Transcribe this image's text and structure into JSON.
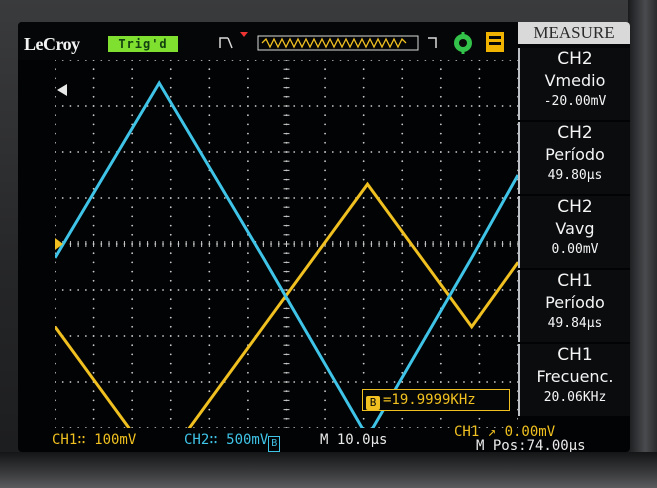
{
  "brand": "LeCroy",
  "run_status": "Trig'd",
  "header": {
    "mode": "MEASURE"
  },
  "measurements": [
    {
      "channel": "CH2",
      "name": "Vmedio",
      "value": "-20.00mV"
    },
    {
      "channel": "CH2",
      "name": "Período",
      "value": "49.80µs"
    },
    {
      "channel": "CH2",
      "name": "Vavg",
      "value": "0.00mV"
    },
    {
      "channel": "CH1",
      "name": "Período",
      "value": "49.84µs"
    },
    {
      "channel": "CH1",
      "name": "Frecuenc.",
      "value": "20.06KHz"
    }
  ],
  "frequency_counter": {
    "icon": "B",
    "text": "=19.9999KHz"
  },
  "bottom": {
    "ch1": "CH1∷ 100mV",
    "ch2": "CH2∷ 500mV",
    "ch2_bw": "B",
    "timebase": "M 10.0µs",
    "trigger": "CH1 ↗ 0.00mV",
    "mpos": "M Pos:74.00µs"
  },
  "colors": {
    "ch1": "#f0c020",
    "ch2": "#3fc4e8",
    "grid": "#c9c9c9",
    "run": "#7fe02f"
  },
  "chart_data": {
    "type": "line",
    "title": "",
    "xlabel": "",
    "ylabel": "",
    "grid": true,
    "x_divisions": 12,
    "y_divisions": 8,
    "x": [
      0,
      2.7,
      5.4,
      8.1,
      10.8,
      12.0
    ],
    "series": [
      {
        "name": "CH1",
        "values": [
          -1.8,
          -4.9,
          -1.8,
          1.3,
          -1.8,
          -0.4
        ]
      },
      {
        "name": "CH2",
        "values": [
          -0.3,
          3.5,
          -0.3,
          -4.2,
          -0.3,
          1.5
        ]
      }
    ]
  }
}
